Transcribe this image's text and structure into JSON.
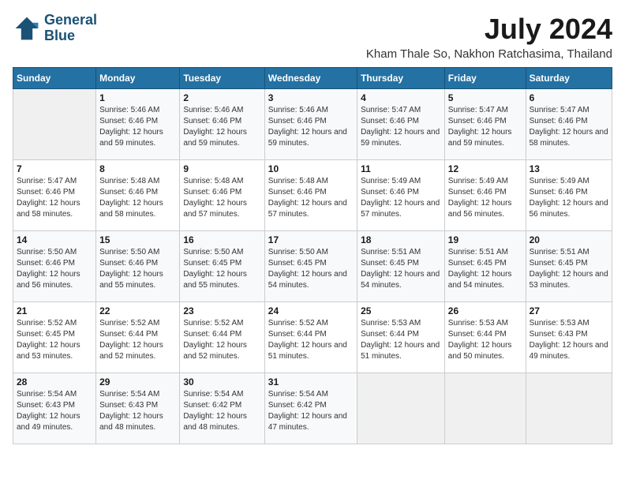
{
  "logo": {
    "line1": "General",
    "line2": "Blue"
  },
  "title": "July 2024",
  "subtitle": "Kham Thale So, Nakhon Ratchasima, Thailand",
  "header_row": [
    "Sunday",
    "Monday",
    "Tuesday",
    "Wednesday",
    "Thursday",
    "Friday",
    "Saturday"
  ],
  "weeks": [
    [
      {
        "day": "",
        "sunrise": "",
        "sunset": "",
        "daylight": ""
      },
      {
        "day": "1",
        "sunrise": "Sunrise: 5:46 AM",
        "sunset": "Sunset: 6:46 PM",
        "daylight": "Daylight: 12 hours and 59 minutes."
      },
      {
        "day": "2",
        "sunrise": "Sunrise: 5:46 AM",
        "sunset": "Sunset: 6:46 PM",
        "daylight": "Daylight: 12 hours and 59 minutes."
      },
      {
        "day": "3",
        "sunrise": "Sunrise: 5:46 AM",
        "sunset": "Sunset: 6:46 PM",
        "daylight": "Daylight: 12 hours and 59 minutes."
      },
      {
        "day": "4",
        "sunrise": "Sunrise: 5:47 AM",
        "sunset": "Sunset: 6:46 PM",
        "daylight": "Daylight: 12 hours and 59 minutes."
      },
      {
        "day": "5",
        "sunrise": "Sunrise: 5:47 AM",
        "sunset": "Sunset: 6:46 PM",
        "daylight": "Daylight: 12 hours and 59 minutes."
      },
      {
        "day": "6",
        "sunrise": "Sunrise: 5:47 AM",
        "sunset": "Sunset: 6:46 PM",
        "daylight": "Daylight: 12 hours and 58 minutes."
      }
    ],
    [
      {
        "day": "7",
        "sunrise": "Sunrise: 5:47 AM",
        "sunset": "Sunset: 6:46 PM",
        "daylight": "Daylight: 12 hours and 58 minutes."
      },
      {
        "day": "8",
        "sunrise": "Sunrise: 5:48 AM",
        "sunset": "Sunset: 6:46 PM",
        "daylight": "Daylight: 12 hours and 58 minutes."
      },
      {
        "day": "9",
        "sunrise": "Sunrise: 5:48 AM",
        "sunset": "Sunset: 6:46 PM",
        "daylight": "Daylight: 12 hours and 57 minutes."
      },
      {
        "day": "10",
        "sunrise": "Sunrise: 5:48 AM",
        "sunset": "Sunset: 6:46 PM",
        "daylight": "Daylight: 12 hours and 57 minutes."
      },
      {
        "day": "11",
        "sunrise": "Sunrise: 5:49 AM",
        "sunset": "Sunset: 6:46 PM",
        "daylight": "Daylight: 12 hours and 57 minutes."
      },
      {
        "day": "12",
        "sunrise": "Sunrise: 5:49 AM",
        "sunset": "Sunset: 6:46 PM",
        "daylight": "Daylight: 12 hours and 56 minutes."
      },
      {
        "day": "13",
        "sunrise": "Sunrise: 5:49 AM",
        "sunset": "Sunset: 6:46 PM",
        "daylight": "Daylight: 12 hours and 56 minutes."
      }
    ],
    [
      {
        "day": "14",
        "sunrise": "Sunrise: 5:50 AM",
        "sunset": "Sunset: 6:46 PM",
        "daylight": "Daylight: 12 hours and 56 minutes."
      },
      {
        "day": "15",
        "sunrise": "Sunrise: 5:50 AM",
        "sunset": "Sunset: 6:46 PM",
        "daylight": "Daylight: 12 hours and 55 minutes."
      },
      {
        "day": "16",
        "sunrise": "Sunrise: 5:50 AM",
        "sunset": "Sunset: 6:45 PM",
        "daylight": "Daylight: 12 hours and 55 minutes."
      },
      {
        "day": "17",
        "sunrise": "Sunrise: 5:50 AM",
        "sunset": "Sunset: 6:45 PM",
        "daylight": "Daylight: 12 hours and 54 minutes."
      },
      {
        "day": "18",
        "sunrise": "Sunrise: 5:51 AM",
        "sunset": "Sunset: 6:45 PM",
        "daylight": "Daylight: 12 hours and 54 minutes."
      },
      {
        "day": "19",
        "sunrise": "Sunrise: 5:51 AM",
        "sunset": "Sunset: 6:45 PM",
        "daylight": "Daylight: 12 hours and 54 minutes."
      },
      {
        "day": "20",
        "sunrise": "Sunrise: 5:51 AM",
        "sunset": "Sunset: 6:45 PM",
        "daylight": "Daylight: 12 hours and 53 minutes."
      }
    ],
    [
      {
        "day": "21",
        "sunrise": "Sunrise: 5:52 AM",
        "sunset": "Sunset: 6:45 PM",
        "daylight": "Daylight: 12 hours and 53 minutes."
      },
      {
        "day": "22",
        "sunrise": "Sunrise: 5:52 AM",
        "sunset": "Sunset: 6:44 PM",
        "daylight": "Daylight: 12 hours and 52 minutes."
      },
      {
        "day": "23",
        "sunrise": "Sunrise: 5:52 AM",
        "sunset": "Sunset: 6:44 PM",
        "daylight": "Daylight: 12 hours and 52 minutes."
      },
      {
        "day": "24",
        "sunrise": "Sunrise: 5:52 AM",
        "sunset": "Sunset: 6:44 PM",
        "daylight": "Daylight: 12 hours and 51 minutes."
      },
      {
        "day": "25",
        "sunrise": "Sunrise: 5:53 AM",
        "sunset": "Sunset: 6:44 PM",
        "daylight": "Daylight: 12 hours and 51 minutes."
      },
      {
        "day": "26",
        "sunrise": "Sunrise: 5:53 AM",
        "sunset": "Sunset: 6:44 PM",
        "daylight": "Daylight: 12 hours and 50 minutes."
      },
      {
        "day": "27",
        "sunrise": "Sunrise: 5:53 AM",
        "sunset": "Sunset: 6:43 PM",
        "daylight": "Daylight: 12 hours and 49 minutes."
      }
    ],
    [
      {
        "day": "28",
        "sunrise": "Sunrise: 5:54 AM",
        "sunset": "Sunset: 6:43 PM",
        "daylight": "Daylight: 12 hours and 49 minutes."
      },
      {
        "day": "29",
        "sunrise": "Sunrise: 5:54 AM",
        "sunset": "Sunset: 6:43 PM",
        "daylight": "Daylight: 12 hours and 48 minutes."
      },
      {
        "day": "30",
        "sunrise": "Sunrise: 5:54 AM",
        "sunset": "Sunset: 6:42 PM",
        "daylight": "Daylight: 12 hours and 48 minutes."
      },
      {
        "day": "31",
        "sunrise": "Sunrise: 5:54 AM",
        "sunset": "Sunset: 6:42 PM",
        "daylight": "Daylight: 12 hours and 47 minutes."
      },
      {
        "day": "",
        "sunrise": "",
        "sunset": "",
        "daylight": ""
      },
      {
        "day": "",
        "sunrise": "",
        "sunset": "",
        "daylight": ""
      },
      {
        "day": "",
        "sunrise": "",
        "sunset": "",
        "daylight": ""
      }
    ]
  ]
}
